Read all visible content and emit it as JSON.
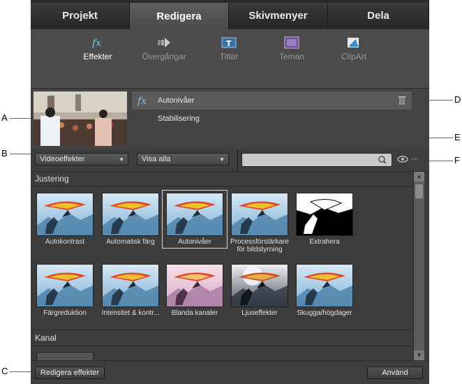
{
  "tabs": [
    {
      "label": "Projekt",
      "active": false
    },
    {
      "label": "Redigera",
      "active": true
    },
    {
      "label": "Skivmenyer",
      "active": false
    },
    {
      "label": "Dela",
      "active": false
    }
  ],
  "tools": [
    {
      "label": "Effekter",
      "icon": "fx-icon",
      "active": true
    },
    {
      "label": "Övergångar",
      "icon": "transition-arrow-icon",
      "active": false
    },
    {
      "label": "Titlar",
      "icon": "title-icon",
      "active": false
    },
    {
      "label": "Teman",
      "icon": "theme-icon",
      "active": false
    },
    {
      "label": "ClipArt",
      "icon": "clipart-icon",
      "active": false
    }
  ],
  "applied_effects": [
    {
      "label": "Autonivåer",
      "selected": true
    },
    {
      "label": "Stabilisering",
      "selected": false
    }
  ],
  "filters": {
    "category": "Videoeffekter",
    "view": "Visa alla"
  },
  "sections": [
    {
      "title": "Justering",
      "items": [
        {
          "label": "Autokontrast",
          "style": "normal"
        },
        {
          "label": "Automatisk färg",
          "style": "normal"
        },
        {
          "label": "Autonivåer",
          "style": "normal",
          "selected": true
        },
        {
          "label": "Processförstärkare för bildstyrning",
          "style": "normal"
        },
        {
          "label": "Extrahera",
          "style": "bw"
        },
        {
          "label": "Färgreduktion",
          "style": "normal"
        },
        {
          "label": "Intensitet & kontr...",
          "style": "normal"
        },
        {
          "label": "Blanda kanaler",
          "style": "pink"
        },
        {
          "label": "Ljuseffekter",
          "style": "dark"
        },
        {
          "label": "Skugga/högdager",
          "style": "normal"
        }
      ]
    },
    {
      "title": "Kanal",
      "items": []
    }
  ],
  "buttons": {
    "edit_effects": "Redigera effekter",
    "apply": "Använd"
  },
  "callouts": {
    "a": "A",
    "b": "B",
    "c": "C",
    "d": "D",
    "e": "E",
    "f": "F"
  },
  "colors": {
    "panel": "#3a3a3a",
    "active_tab": "#555555",
    "accent_fx": "#5ab0d8"
  }
}
